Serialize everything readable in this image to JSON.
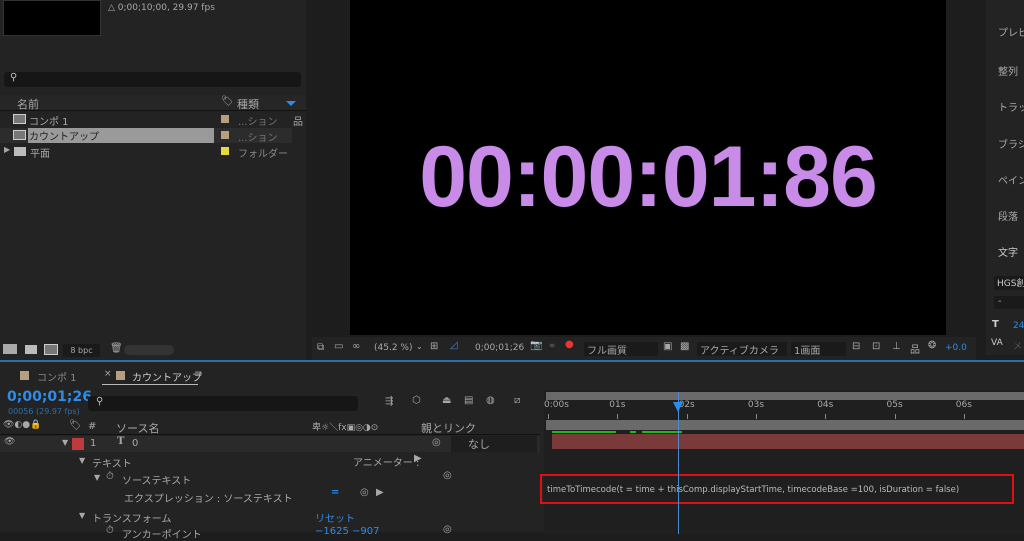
{
  "project": {
    "comp_info": "△ 0;00;10;00, 29.97 fps",
    "search_placeholder": "",
    "col_name": "名前",
    "col_type": "種類",
    "items": [
      {
        "name": "コンポ 1",
        "type": "...ション",
        "label_color": "#b4a07e",
        "icon": "composition-icon"
      },
      {
        "name": "カウントアップ",
        "type": "...ション",
        "label_color": "#b4a07e",
        "icon": "composition-icon",
        "selected": true
      },
      {
        "name": "平面",
        "type": "フォルダー",
        "label_color": "#e6d93a",
        "icon": "folder-icon"
      }
    ],
    "bpc": "8 bpc"
  },
  "viewer": {
    "display_text": "00:00:01:86",
    "text_color": "#c98be8",
    "zoom": "(45.2 %)",
    "timecode": "0;00;01;26",
    "quality": "フル画質",
    "camera": "アクティブカメラ",
    "views": "1画面",
    "exposure": "+0.0"
  },
  "right_panel": {
    "items": [
      "プレビュー",
      "整列",
      "トラッカー",
      "ブラシ",
      "ペイント",
      "段落",
      "文字"
    ],
    "font": "HGS創",
    "style": "-",
    "font_size": "24",
    "kerning": "メト"
  },
  "timeline": {
    "tabs": [
      {
        "label": "コンポ 1",
        "active": false
      },
      {
        "label": "カウントアップ",
        "active": true
      }
    ],
    "current_time": "0;00;01;26",
    "frame_info": "00056 (29.97 fps)",
    "ruler": [
      "0:00s",
      "01s",
      "02s",
      "03s",
      "04s",
      "05s",
      "06s"
    ],
    "current_time_seconds": 1.87,
    "col_hash": "#",
    "col_source": "ソース名",
    "col_parent": "親とリンク",
    "layer": {
      "num": "1",
      "name": "0",
      "parent": "なし",
      "label_color": "#c0393b"
    },
    "props": {
      "text": "テキスト",
      "animator": "アニメーター :",
      "source_text": "ソーステキスト",
      "expression_label": "エクスプレッション : ソーステキスト",
      "transform": "トランスフォーム",
      "reset": "リセット",
      "anchor": "アンカーポイント",
      "anchor_value": "−1625 −907"
    },
    "expression": "timeToTimecode(t = time + thisComp.displayStartTime, timecodeBase =100, isDuration = false)"
  }
}
